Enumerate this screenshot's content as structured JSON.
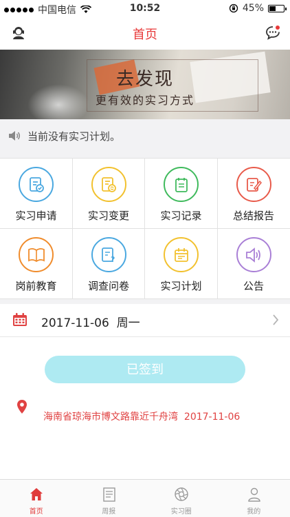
{
  "status_bar": {
    "carrier": "中国电信",
    "time": "10:52",
    "battery": "45%",
    "battery_level": 0.45
  },
  "nav": {
    "title": "首页",
    "left_icon": "avatar-icon",
    "right_icon": "message-icon"
  },
  "banner": {
    "title": "去发现",
    "subtitle": "更有效的实习方式"
  },
  "notice": {
    "icon": "speaker-icon",
    "text": "当前没有实习计划。"
  },
  "menu": [
    {
      "label": "实习申请",
      "icon": "apply-icon",
      "color": "#4aa8e0"
    },
    {
      "label": "实习变更",
      "icon": "change-icon",
      "color": "#f2c12e"
    },
    {
      "label": "实习记录",
      "icon": "record-icon",
      "color": "#3fba5c"
    },
    {
      "label": "总结报告",
      "icon": "report-icon",
      "color": "#e85a4a"
    },
    {
      "label": "岗前教育",
      "icon": "book-icon",
      "color": "#f08c2c"
    },
    {
      "label": "调查问卷",
      "icon": "survey-icon",
      "color": "#4aa8e0"
    },
    {
      "label": "实习计划",
      "icon": "plan-icon",
      "color": "#f2c12e"
    },
    {
      "label": "公告",
      "icon": "announce-icon",
      "color": "#a97fd6"
    }
  ],
  "date_row": {
    "date": "2017-11-06",
    "weekday": "周一"
  },
  "checkin": {
    "button_label": "已签到",
    "location": "海南省琼海市博文路靠近千舟湾",
    "date": "2017-11-06"
  },
  "tabs": [
    {
      "label": "首页",
      "icon": "home-icon",
      "active": true
    },
    {
      "label": "周报",
      "icon": "weekly-report-icon",
      "active": false
    },
    {
      "label": "实习圈",
      "icon": "aperture-icon",
      "active": false
    },
    {
      "label": "我的",
      "icon": "user-icon",
      "active": false
    }
  ],
  "colors": {
    "accent": "#e83a3a",
    "signed_button": "#aeeaf2"
  }
}
